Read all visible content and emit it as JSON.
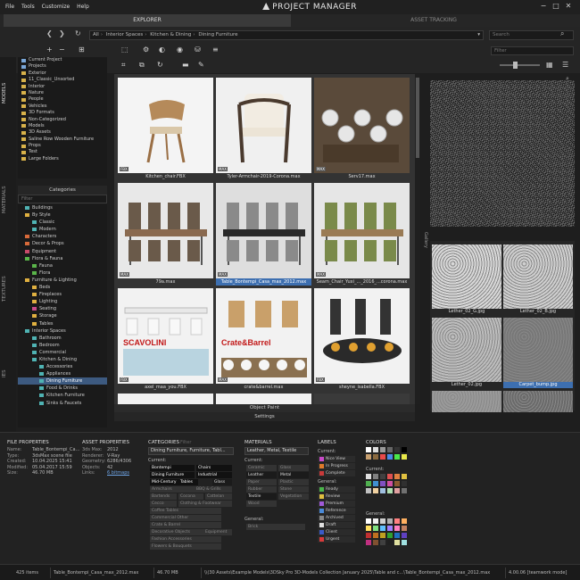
{
  "menu": [
    "File",
    "Tools",
    "Customize",
    "Help"
  ],
  "app_title": "PROJECT MANAGER",
  "window_controls": [
    "−",
    "□",
    "✕"
  ],
  "tabs": {
    "explorer": "EXPLORER",
    "asset_tracking": "ASSET TRACKING"
  },
  "breadcrumb": [
    "All",
    "Interior Spaces",
    "Kitchen & Dining",
    "Dining Furniture"
  ],
  "search_placeholder": "Search",
  "filter_placeholder": "Filter",
  "side_tabs": [
    "MODELS",
    "MATERIALS",
    "TEXTURES",
    "IES"
  ],
  "folder_tree": [
    {
      "label": "Current Project",
      "kind": "lib"
    },
    {
      "label": "Projects",
      "kind": "lib"
    },
    {
      "label": "Exterior",
      "kind": "folder"
    },
    {
      "label": "11_Classic_Unsorted",
      "kind": "folder"
    },
    {
      "label": "Interior",
      "kind": "folder"
    },
    {
      "label": "Nature",
      "kind": "folder"
    },
    {
      "label": "People",
      "kind": "folder"
    },
    {
      "label": "Vehicles",
      "kind": "folder"
    },
    {
      "label": "3D Formats",
      "kind": "folder"
    },
    {
      "label": "Non-Categorized",
      "kind": "folder"
    },
    {
      "label": "Models",
      "kind": "folder"
    },
    {
      "label": "3D Assets",
      "kind": "folder"
    },
    {
      "label": "Saline Row Wooden Furniture",
      "kind": "folder"
    },
    {
      "label": "Props",
      "kind": "folder"
    },
    {
      "label": "Test",
      "kind": "folder"
    },
    {
      "label": "Large Folders",
      "kind": "folder"
    }
  ],
  "categories_header": "Categories",
  "categories_filter": "Filter",
  "categories": [
    {
      "label": "Buildings",
      "indent": 1,
      "color": "#4fb3b3"
    },
    {
      "label": "By Style",
      "indent": 1,
      "color": "#e0b040"
    },
    {
      "label": "Classic",
      "indent": 2,
      "color": "#4fb3b3"
    },
    {
      "label": "Modern",
      "indent": 2,
      "color": "#4fb3b3"
    },
    {
      "label": "Characters",
      "indent": 1,
      "color": "#d86a3a"
    },
    {
      "label": "Decor & Props",
      "indent": 1,
      "color": "#d86a3a"
    },
    {
      "label": "Equipment",
      "indent": 1,
      "color": "#c84a6a"
    },
    {
      "label": "Flora & Fauna",
      "indent": 1,
      "color": "#5ab54a"
    },
    {
      "label": "Fauna",
      "indent": 2,
      "color": "#5ab54a"
    },
    {
      "label": "Flora",
      "indent": 2,
      "color": "#5ab54a"
    },
    {
      "label": "Furniture & Lighting",
      "indent": 1,
      "color": "#e0b040"
    },
    {
      "label": "Beds",
      "indent": 2,
      "color": "#e0b040"
    },
    {
      "label": "Fireplaces",
      "indent": 2,
      "color": "#e0b040"
    },
    {
      "label": "Lighting",
      "indent": 2,
      "color": "#e0b040"
    },
    {
      "label": "Seating",
      "indent": 2,
      "color": "#c84a8a"
    },
    {
      "label": "Storage",
      "indent": 2,
      "color": "#e0b040"
    },
    {
      "label": "Tables",
      "indent": 2,
      "color": "#e0b040"
    },
    {
      "label": "Interior Spaces",
      "indent": 1,
      "color": "#4fb3b3"
    },
    {
      "label": "Bathroom",
      "indent": 2,
      "color": "#4fb3b3"
    },
    {
      "label": "Bedroom",
      "indent": 2,
      "color": "#4fb3b3"
    },
    {
      "label": "Commercial",
      "indent": 2,
      "color": "#4fb3b3"
    },
    {
      "label": "Kitchen & Dining",
      "indent": 2,
      "color": "#4fb3b3"
    },
    {
      "label": "Accessories",
      "indent": 3,
      "color": "#4fb3b3"
    },
    {
      "label": "Appliances",
      "indent": 3,
      "color": "#4fb3b3"
    },
    {
      "label": "Dining Furniture",
      "indent": 3,
      "color": "#4fb3b3",
      "selected": true
    },
    {
      "label": "Food & Drinks",
      "indent": 3,
      "color": "#4fb3b3"
    },
    {
      "label": "Kitchen Furniture",
      "indent": 3,
      "color": "#4fb3b3"
    },
    {
      "label": "Sinks & Faucets",
      "indent": 3,
      "color": "#4fb3b3"
    }
  ],
  "thumbnails": [
    {
      "label": "Kitchen_chair.FBX",
      "badge": "FBX",
      "art": "chair",
      "bg": "#f4f4f4"
    },
    {
      "label": "Tyler-Armchair-2019-Corona.max",
      "badge": "MAX",
      "art": "armchair",
      "bg": "#f0f0f0"
    },
    {
      "label": "Serv17.max",
      "badge": "MAX",
      "art": "tableware",
      "bg": "#3a3a3a"
    },
    {
      "label": "79a.max",
      "badge": "MAX",
      "art": "dining",
      "bg": "#e8e8e8"
    },
    {
      "label": "Table_Bontempi_Casa_max_2012.max",
      "badge": "MAX",
      "art": "dining2",
      "bg": "#dedede",
      "selected": true
    },
    {
      "label": "Seam_Chair_Yuxi_..._2016_...corona.max",
      "badge": "MAX",
      "art": "dining3",
      "bg": "#e6e6e6"
    },
    {
      "label": "axel_maa_you.FBX",
      "badge": "FBX",
      "art": "scavolini",
      "bg": "#f2f2f2",
      "brand": "SCAVOLINI"
    },
    {
      "label": "crate&barrel.max",
      "badge": "MAX",
      "art": "crate",
      "bg": "#f2f2f2",
      "brand": "Crate&Barrel"
    },
    {
      "label": "sheyne_isabella.FBX",
      "badge": "FBX",
      "art": "black",
      "bg": "#f2f2f2"
    },
    {
      "label": "",
      "badge": "",
      "art": "partial",
      "bg": "#f2f2f2"
    },
    {
      "label": "",
      "badge": "",
      "art": "partial2",
      "bg": "#f2f2f2"
    },
    {
      "label": "",
      "badge": "",
      "art": "partial3",
      "bg": "#3a3a3a"
    }
  ],
  "grid_footer": {
    "object_paint": "Object Paint",
    "settings": "Settings"
  },
  "gallery_side_label": "Gallery",
  "gallery": [
    {
      "label": "Lether_02_G.jpg",
      "tone": "#d8d8d8"
    },
    {
      "label": "Lether_02_B.jpg",
      "tone": "#cfcfcf"
    },
    {
      "label": "Lether_02.jpg",
      "tone": "#bdbdbd"
    },
    {
      "label": "Carpet_bump.jpg",
      "tone": "#777",
      "selected": true
    },
    {
      "label": "",
      "tone": "#9a9a9a"
    },
    {
      "label": "",
      "tone": "#6a6a6a"
    }
  ],
  "file_props": {
    "title": "FILE PROPERTIES",
    "rows": [
      [
        "Name:",
        "Table_Bontempi_Ca..."
      ],
      [
        "Type:",
        "3dsMax scene file"
      ],
      [
        "Created:",
        "10.04.2025 15:41"
      ],
      [
        "Modified:",
        "05.04.2017 15:59"
      ],
      [
        "Size:",
        "46.70 MB"
      ]
    ]
  },
  "asset_props": {
    "title": "ASSET PROPERTIES",
    "rows": [
      [
        "3ds Max:",
        "2012"
      ],
      [
        "Renderer:",
        "V-Ray"
      ],
      [
        "Geometry:",
        "6286/4306"
      ],
      [
        "Objects:",
        "42"
      ],
      [
        "Links:",
        "6 bitmaps"
      ]
    ]
  },
  "categories_panel": {
    "title": "CATEGORIES",
    "filter": "Filter",
    "current_value": "Dining Furniture, Furniture, Tabl...",
    "current_label": "Current:",
    "tags": [
      {
        "label": "Bontempi",
        "state": "on"
      },
      {
        "label": "Chairs",
        "state": "on"
      },
      {
        "label": "Dining Furniture",
        "state": "on"
      },
      {
        "label": "Industrial",
        "state": "on"
      },
      {
        "label": "Mid-Century",
        "state": "on"
      },
      {
        "label": "Tables",
        "state": "on"
      },
      {
        "label": "Glass",
        "state": "sel"
      },
      {
        "label": "Armchairs",
        "state": "off"
      },
      {
        "label": "BBQ & Grills",
        "state": "off"
      },
      {
        "label": "Bartends",
        "state": "off"
      },
      {
        "label": "Cocona",
        "state": "off"
      },
      {
        "label": "Cattelan",
        "state": "off"
      },
      {
        "label": "Cecco",
        "state": "off"
      },
      {
        "label": "Clothing & Footwear",
        "state": "off"
      },
      {
        "label": "Coffee Tables",
        "state": "off"
      },
      {
        "label": "Commercial Other",
        "state": "off"
      },
      {
        "label": "Crate & Barrel",
        "state": "off"
      },
      {
        "label": "Decorative Objects",
        "state": "off"
      },
      {
        "label": "Equipment",
        "state": "off"
      },
      {
        "label": "Fashion Accessories",
        "state": "off"
      },
      {
        "label": "Flowers & Bouquets",
        "state": "off"
      }
    ]
  },
  "materials_panel": {
    "title": "MATERIALS",
    "current_value": "Leather, Metal, Textile",
    "current_label": "Current:",
    "general_label": "General:",
    "tags": [
      {
        "label": "Ceramic",
        "state": "off"
      },
      {
        "label": "Glass",
        "state": "off"
      },
      {
        "label": "Leather",
        "state": "on"
      },
      {
        "label": "Metal",
        "state": "on"
      },
      {
        "label": "Paper",
        "state": "off"
      },
      {
        "label": "Plastic",
        "state": "off"
      },
      {
        "label": "Rubber",
        "state": "off"
      },
      {
        "label": "Stone",
        "state": "off"
      },
      {
        "label": "Textile",
        "state": "on"
      },
      {
        "label": "Vegetation",
        "state": "off"
      },
      {
        "label": "Wood",
        "state": "off"
      }
    ],
    "general_tags": [
      "Brick"
    ]
  },
  "labels_panel": {
    "title": "LABELS",
    "current_label": "Current:",
    "general_label": "General:",
    "current": [
      {
        "label": "Nice View",
        "color": "#c84ac8"
      },
      {
        "label": "In Progress",
        "color": "#e07a2a"
      },
      {
        "label": "Complete",
        "color": "#c83a3a"
      }
    ],
    "general": [
      {
        "label": "Ready",
        "color": "#4ab54a"
      },
      {
        "label": "Review",
        "color": "#e0c040"
      },
      {
        "label": "Premium",
        "color": "#a05ad8"
      },
      {
        "label": "Reference",
        "color": "#4a8ad8"
      },
      {
        "label": "Archived",
        "color": "#888888"
      },
      {
        "label": "Draft",
        "color": "#e0e0e0"
      },
      {
        "label": "Client",
        "color": "#3a5ac8"
      },
      {
        "label": "Urgent",
        "color": "#d83a3a"
      }
    ]
  },
  "colors_panel": {
    "title": "COLORS",
    "current_label": "Current:",
    "general_label": "General:",
    "top": [
      "#ffffff",
      "#dddddd",
      "#999999",
      "#666666",
      "#333333",
      "#000000",
      "#c8a070",
      "#8a6a40",
      "#e84a4a",
      "#4a8ae8",
      "#4ae84a",
      "#e8e84a"
    ],
    "current": [
      "#e0e0e0",
      "#808080",
      "#404040",
      "#e05050",
      "#e08040",
      "#e0c040",
      "#50b050",
      "#4090d0",
      "#8050c0",
      "#d050a0",
      "#8a5a30",
      "#303030",
      "#c0c0c0",
      "#f0d0a0",
      "#a0c0e0",
      "#b0e0b0",
      "#e0a0a0",
      "#707070"
    ],
    "general": [
      "#ffffff",
      "#f0f0f0",
      "#d0d0d0",
      "#b0b0b0",
      "#ff8080",
      "#ffb060",
      "#ffe060",
      "#80e080",
      "#60c0ff",
      "#a080ff",
      "#ff80c0",
      "#c08060",
      "#c03030",
      "#c07020",
      "#c0a020",
      "#30a030",
      "#2070c0",
      "#6040c0",
      "#c03080",
      "#805030",
      "#404040",
      "#202020",
      "#e0e0a0",
      "#a0e0e0"
    ]
  },
  "status": {
    "items": "425 items",
    "file": "Table_Bontempi_Casa_max_2012.max",
    "size": "46.70 MB",
    "path": "\\\\(30 Assets\\Example Models\\3DSky Pro 3D-Models Collection January 2025\\Table and c...\\Table_Bontempi_Casa_max_2012.max",
    "version": "4.00.06 [teamwork mode]"
  }
}
